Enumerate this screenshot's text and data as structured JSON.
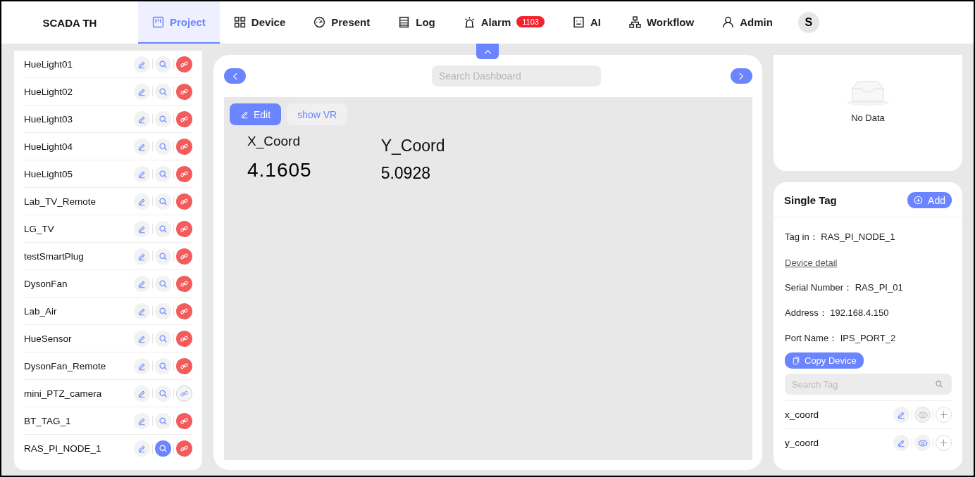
{
  "app": {
    "title": "SCADA TH"
  },
  "nav": [
    {
      "label": "Project",
      "selected": true
    },
    {
      "label": "Device",
      "selected": false
    },
    {
      "label": "Present",
      "selected": false
    },
    {
      "label": "Log",
      "selected": false
    },
    {
      "label": "Alarm",
      "selected": false,
      "badge": "1103"
    },
    {
      "label": "AI",
      "selected": false
    },
    {
      "label": "Workflow",
      "selected": false
    },
    {
      "label": "Admin",
      "selected": false
    }
  ],
  "user": {
    "initial": "S"
  },
  "devices": [
    {
      "name": "HueLight01",
      "connected": true,
      "selected": false
    },
    {
      "name": "HueLight02",
      "connected": true,
      "selected": false
    },
    {
      "name": "HueLight03",
      "connected": true,
      "selected": false
    },
    {
      "name": "HueLight04",
      "connected": true,
      "selected": false
    },
    {
      "name": "HueLight05",
      "connected": true,
      "selected": false
    },
    {
      "name": "Lab_TV_Remote",
      "connected": true,
      "selected": false
    },
    {
      "name": "LG_TV",
      "connected": true,
      "selected": false
    },
    {
      "name": "testSmartPlug",
      "connected": true,
      "selected": false
    },
    {
      "name": "DysonFan",
      "connected": true,
      "selected": false
    },
    {
      "name": "Lab_Air",
      "connected": true,
      "selected": false
    },
    {
      "name": "HueSensor",
      "connected": true,
      "selected": false
    },
    {
      "name": "DysonFan_Remote",
      "connected": true,
      "selected": false
    },
    {
      "name": "mini_PTZ_camera",
      "connected": false,
      "selected": false
    },
    {
      "name": "BT_TAG_1",
      "connected": true,
      "selected": false
    },
    {
      "name": "RAS_PI_NODE_1",
      "connected": true,
      "selected": true
    }
  ],
  "dashboard": {
    "search": {
      "placeholder": "Search Dashboard"
    },
    "buttons": [
      {
        "label": "Edit",
        "kind": "primary"
      },
      {
        "label": "show VR",
        "kind": "secondary"
      }
    ],
    "widgets": [
      {
        "label": "X_Coord",
        "value": "4.1605"
      },
      {
        "label": "Y_Coord",
        "value": "5.0928"
      }
    ]
  },
  "empty_card": {
    "text": "No Data"
  },
  "single_tag": {
    "title": "Single Tag",
    "add": "Add",
    "fields": [
      {
        "label": "Tag in：",
        "value": "RAS_PI_NODE_1"
      }
    ],
    "link": "Device detail",
    "details": [
      {
        "label": "Serial Number：",
        "value": "RAS_PI_01"
      },
      {
        "label": "Address：",
        "value": "192.168.4.150"
      },
      {
        "label": "Port Name：",
        "value": "IPS_PORT_2"
      }
    ],
    "copy": "Copy Device",
    "search": {
      "placeholder": "Search Tag"
    },
    "tags": [
      {
        "name": "x_coord",
        "visible": false
      },
      {
        "name": "y_coord",
        "visible": true
      }
    ]
  }
}
